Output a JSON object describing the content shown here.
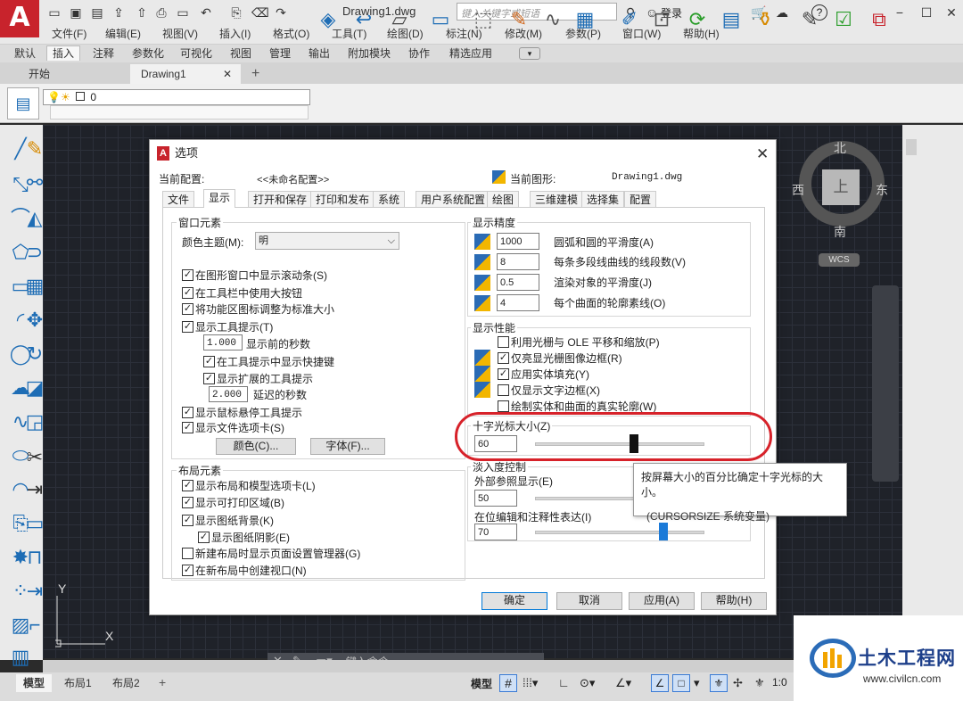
{
  "app": {
    "logo": "A",
    "document_title": "Drawing1.dwg",
    "search_placeholder": "键入关键字或短语",
    "login": "登录",
    "help": "?"
  },
  "menu": [
    "文件(F)",
    "编辑(E)",
    "视图(V)",
    "插入(I)",
    "格式(O)",
    "工具(T)",
    "绘图(D)",
    "标注(N)",
    "修改(M)",
    "参数(P)",
    "窗口(W)",
    "帮助(H)"
  ],
  "ribbon_tabs": [
    "默认",
    "插入",
    "注释",
    "参数化",
    "可视化",
    "视图",
    "管理",
    "输出",
    "附加模块",
    "协作",
    "精选应用"
  ],
  "ribbon_active_tab": "插入",
  "file_tabs": [
    "开始",
    "Drawing1"
  ],
  "layer": {
    "value": "0"
  },
  "viewcube": {
    "north": "北",
    "south": "南",
    "east": "东",
    "west": "西",
    "top": "上",
    "wcs": "WCS"
  },
  "ucs": {
    "x": "X",
    "y": "Y"
  },
  "command": {
    "placeholder": "键入命令"
  },
  "layout_tabs": [
    "模型",
    "布局1",
    "布局2"
  ],
  "status": {
    "model": "模型",
    "scale": "1:0"
  },
  "dialog": {
    "title": "选项",
    "current_profile_label": "当前配置:",
    "current_profile_value": "<<未命名配置>>",
    "current_drawing_label": "当前图形:",
    "current_drawing_value": "Drawing1.dwg",
    "tabs": [
      "文件",
      "显示",
      "打开和保存",
      "打印和发布",
      "系统",
      "用户系统配置",
      "绘图",
      "三维建模",
      "选择集",
      "配置"
    ],
    "active_tab": "显示",
    "window_elements": {
      "title": "窗口元素",
      "color_scheme_label": "颜色主题(M):",
      "color_scheme_value": "明",
      "checks": [
        {
          "label": "在图形窗口中显示滚动条(S)",
          "checked": true
        },
        {
          "label": "在工具栏中使用大按钮",
          "checked": true
        },
        {
          "label": "将功能区图标调整为标准大小",
          "checked": true
        },
        {
          "label": "显示工具提示(T)",
          "checked": true
        }
      ],
      "tooltip_delay_value": "1.000",
      "tooltip_delay_label": "显示前的秒数",
      "show_shortcut": {
        "label": "在工具提示中显示快捷键",
        "checked": true
      },
      "show_extended": {
        "label": "显示扩展的工具提示",
        "checked": true
      },
      "extended_delay_value": "2.000",
      "extended_delay_label": "延迟的秒数",
      "checks2": [
        {
          "label": "显示鼠标悬停工具提示",
          "checked": true
        },
        {
          "label": "显示文件选项卡(S)",
          "checked": true
        }
      ],
      "colors_button": "颜色(C)...",
      "fonts_button": "字体(F)..."
    },
    "layout_elements": {
      "title": "布局元素",
      "checks": [
        {
          "label": "显示布局和模型选项卡(L)",
          "checked": true
        },
        {
          "label": "显示可打印区域(B)",
          "checked": true
        },
        {
          "label": "显示图纸背景(K)",
          "checked": true
        }
      ],
      "paper_shadow": {
        "label": "显示图纸阴影(E)",
        "checked": true
      },
      "checks2": [
        {
          "label": "新建布局时显示页面设置管理器(G)",
          "checked": false
        },
        {
          "label": "在新布局中创建视口(N)",
          "checked": true
        }
      ]
    },
    "display_resolution": {
      "title": "显示精度",
      "items": [
        {
          "value": "1000",
          "label": "圆弧和圆的平滑度(A)"
        },
        {
          "value": "8",
          "label": "每条多段线曲线的线段数(V)"
        },
        {
          "value": "0.5",
          "label": "渲染对象的平滑度(J)"
        },
        {
          "value": "4",
          "label": "每个曲面的轮廓素线(O)"
        }
      ]
    },
    "display_performance": {
      "title": "显示性能",
      "items": [
        {
          "label": "利用光栅与 OLE 平移和缩放(P)",
          "checked": false,
          "icon": false
        },
        {
          "label": "仅亮显光栅图像边框(R)",
          "checked": true,
          "icon": true
        },
        {
          "label": "应用实体填充(Y)",
          "checked": true,
          "icon": true
        },
        {
          "label": "仅显示文字边框(X)",
          "checked": false,
          "icon": true
        },
        {
          "label": "绘制实体和曲面的真实轮廓(W)",
          "checked": false,
          "icon": false
        }
      ]
    },
    "crosshair": {
      "title": "十字光标大小(Z)",
      "value": "60",
      "percent": 60
    },
    "fade": {
      "title": "淡入度控制",
      "xref_label": "外部参照显示(E)",
      "xref_value": "50",
      "xref_percent": 50,
      "inplace_label": "在位编辑和注释性表达(I)",
      "inplace_value": "70",
      "inplace_percent": 70
    },
    "buttons": {
      "ok": "确定",
      "cancel": "取消",
      "apply": "应用(A)",
      "help": "帮助(H)"
    }
  },
  "tooltip": {
    "line1": "按屏幕大小的百分比确定十字光标的大小。",
    "line2": "(CURSORSIZE 系统变量)"
  },
  "watermark": {
    "name": "土木工程网",
    "url": "www.civilcn.com"
  },
  "colors": {
    "accent": "#c8232c",
    "highlight_ring": "#d7222a",
    "slider_thumb": "#1b7ad8"
  }
}
